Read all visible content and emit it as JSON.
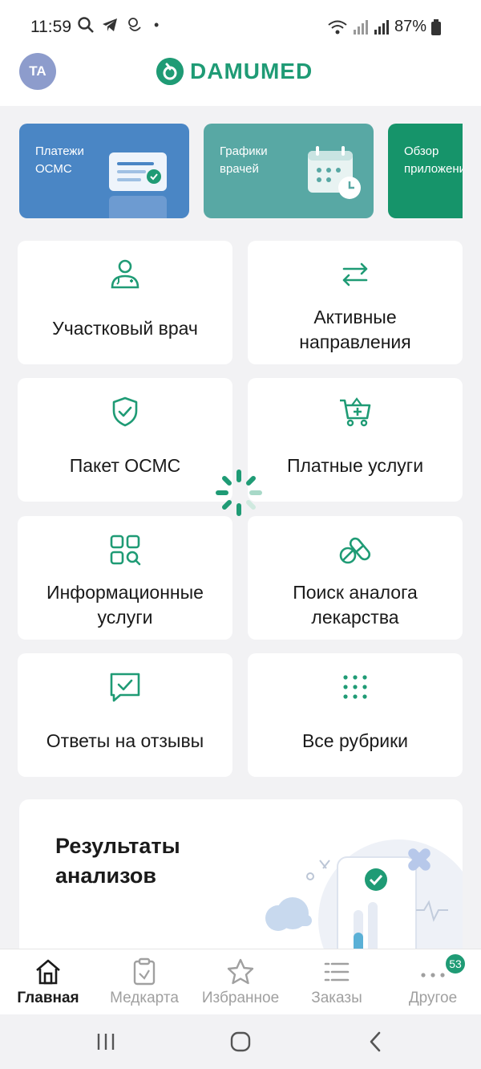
{
  "status_bar": {
    "time": "11:59",
    "dot": "•",
    "battery": "87%"
  },
  "header": {
    "avatar_initials": "TA",
    "logo_text": "DAMUMED"
  },
  "banners": [
    {
      "label": "Платежи\nОСМС",
      "color": "#4a86c5"
    },
    {
      "label": "Графики\nврачей",
      "color": "#58a8a4"
    },
    {
      "label": "Обзор\nприложения",
      "color": "#16946a"
    }
  ],
  "tiles": [
    {
      "label": "Участковый врач",
      "icon": "doctor-icon"
    },
    {
      "label": "Активные\nнаправления",
      "icon": "arrows-exchange-icon"
    },
    {
      "label": "Пакет ОСМС",
      "icon": "shield-check-icon"
    },
    {
      "label": "Платные услуги",
      "icon": "cart-plus-icon"
    },
    {
      "label": "Информационные\nуслуги",
      "icon": "grid-search-icon"
    },
    {
      "label": "Поиск аналога\nлекарства",
      "icon": "pills-icon"
    },
    {
      "label": "Ответы на отзывы",
      "icon": "message-check-icon"
    },
    {
      "label": "Все рубрики",
      "icon": "dots-grid-icon"
    }
  ],
  "results": {
    "title": "Результаты\nанализов"
  },
  "bottom_nav": [
    {
      "label": "Главная",
      "icon": "home-icon",
      "active": true
    },
    {
      "label": "Медкарта",
      "icon": "medcard-icon",
      "active": false
    },
    {
      "label": "Избранное",
      "icon": "star-icon",
      "active": false
    },
    {
      "label": "Заказы",
      "icon": "list-icon",
      "active": false
    },
    {
      "label": "Другое",
      "icon": "more-dots-icon",
      "active": false,
      "badge": "53"
    }
  ],
  "colors": {
    "accent": "#1f9b75",
    "background": "#f2f2f4"
  }
}
